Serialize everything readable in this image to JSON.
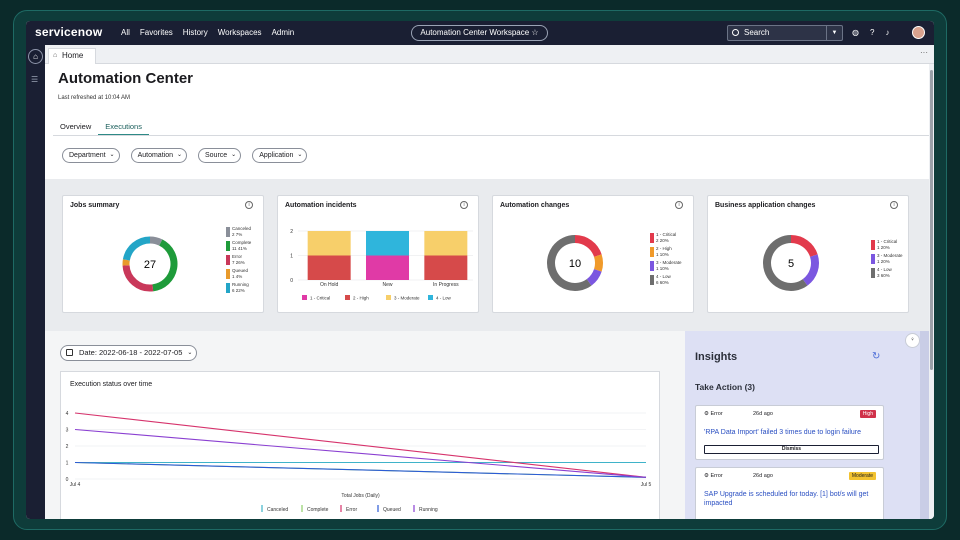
{
  "topbar": {
    "logo": "servicenow",
    "nav": [
      "All",
      "Favorites",
      "History",
      "Workspaces",
      "Admin"
    ],
    "workspace": "Automation Center Workspace ☆",
    "search_placeholder": "Search"
  },
  "tabstrip": {
    "home_label": "Home",
    "more": "···"
  },
  "page": {
    "title": "Automation Center",
    "refreshed": "Last refreshed at 10:04 AM",
    "tabs": [
      "Overview",
      "Executions"
    ],
    "filters": [
      "Department",
      "Automation",
      "Source",
      "Application"
    ]
  },
  "cards": {
    "jobs": {
      "title": "Jobs summary",
      "center": "27",
      "legend": [
        {
          "label": "Canceled",
          "value": "2  7%",
          "color": "#8a8f99"
        },
        {
          "label": "Complete",
          "value": "11  41%",
          "color": "#1e9b3a"
        },
        {
          "label": "Error",
          "value": "7  26%",
          "color": "#c9385a"
        },
        {
          "label": "Queued",
          "value": "1  4%",
          "color": "#e89a2c"
        },
        {
          "label": "Running",
          "value": "6  22%",
          "color": "#23a5c7"
        }
      ]
    },
    "incidents": {
      "title": "Automation incidents"
    },
    "changes": {
      "title": "Automation changes",
      "center": "10",
      "legend": [
        {
          "label": "1 - Critical",
          "value": "2  20%",
          "color": "#e23a4c"
        },
        {
          "label": "2 - High",
          "value": "1  10%",
          "color": "#f09a2a"
        },
        {
          "label": "3 - Moderate",
          "value": "1  10%",
          "color": "#7b57e0"
        },
        {
          "label": "4 - Low",
          "value": "6  60%",
          "color": "#6e6e6e"
        }
      ]
    },
    "business": {
      "title": "Business application changes",
      "center": "5",
      "legend": [
        {
          "label": "1 - Critical",
          "value": "1  20%",
          "color": "#e23a4c"
        },
        {
          "label": "3 - Moderate",
          "value": "1  20%",
          "color": "#7b57e0"
        },
        {
          "label": "4 - Low",
          "value": "3  60%",
          "color": "#6e6e6e"
        }
      ]
    }
  },
  "date_filter": "Date: 2022-06-18 - 2022-07-05",
  "line_chart_title": "Execution status over time",
  "insights": {
    "title": "Insights",
    "take_action": "Take Action (3)",
    "items": [
      {
        "type": "Error",
        "ago": "26d ago",
        "badge": "High",
        "badge_color": "#d0314a",
        "message": "'RPA Data Import' failed 3 times due to login failure",
        "button": "Dismiss"
      },
      {
        "type": "Error",
        "ago": "26d ago",
        "badge": "Moderate",
        "badge_color": "#f2c230",
        "message": "SAP Upgrade is scheduled for today. [1] bot/s will get impacted",
        "button": ""
      }
    ]
  },
  "chart_data": [
    {
      "type": "bar",
      "title": "Automation incidents",
      "categories": [
        "On Hold",
        "New",
        "In Progress"
      ],
      "series": [
        {
          "name": "1 - Critical",
          "values": [
            0,
            1,
            0
          ],
          "color": "#e03aa6"
        },
        {
          "name": "2 - High",
          "values": [
            1,
            0,
            1
          ],
          "color": "#d64a4a"
        },
        {
          "name": "3 - Moderate",
          "values": [
            1,
            0,
            1
          ],
          "color": "#f7cf6a"
        },
        {
          "name": "4 - Low",
          "values": [
            0,
            1,
            0
          ],
          "color": "#2fb5dc"
        }
      ],
      "ylim": [
        0,
        2
      ],
      "yticks": [
        "0",
        "1",
        "2"
      ],
      "legend": "bottom"
    },
    {
      "type": "line",
      "title": "Execution status over time",
      "xlabel": "Total Jobs (Daily)",
      "x": [
        "Jul 4",
        "Jul 5"
      ],
      "ylim": [
        0,
        4
      ],
      "yticks": [
        "0",
        "1",
        "2",
        "3",
        "4"
      ],
      "series": [
        {
          "name": "Canceled",
          "values": [
            1,
            1
          ],
          "color": "#3fb3c9"
        },
        {
          "name": "Complete",
          "values": [
            1,
            0.1
          ],
          "color": "#8fce6a"
        },
        {
          "name": "Error",
          "values": [
            4,
            0.1
          ],
          "color": "#d6336c"
        },
        {
          "name": "Queued",
          "values": [
            1,
            0.1
          ],
          "color": "#2b5bd6"
        },
        {
          "name": "Running",
          "values": [
            3,
            0.1
          ],
          "color": "#8a3fd1"
        }
      ],
      "legend": "bottom",
      "grid": true
    }
  ]
}
